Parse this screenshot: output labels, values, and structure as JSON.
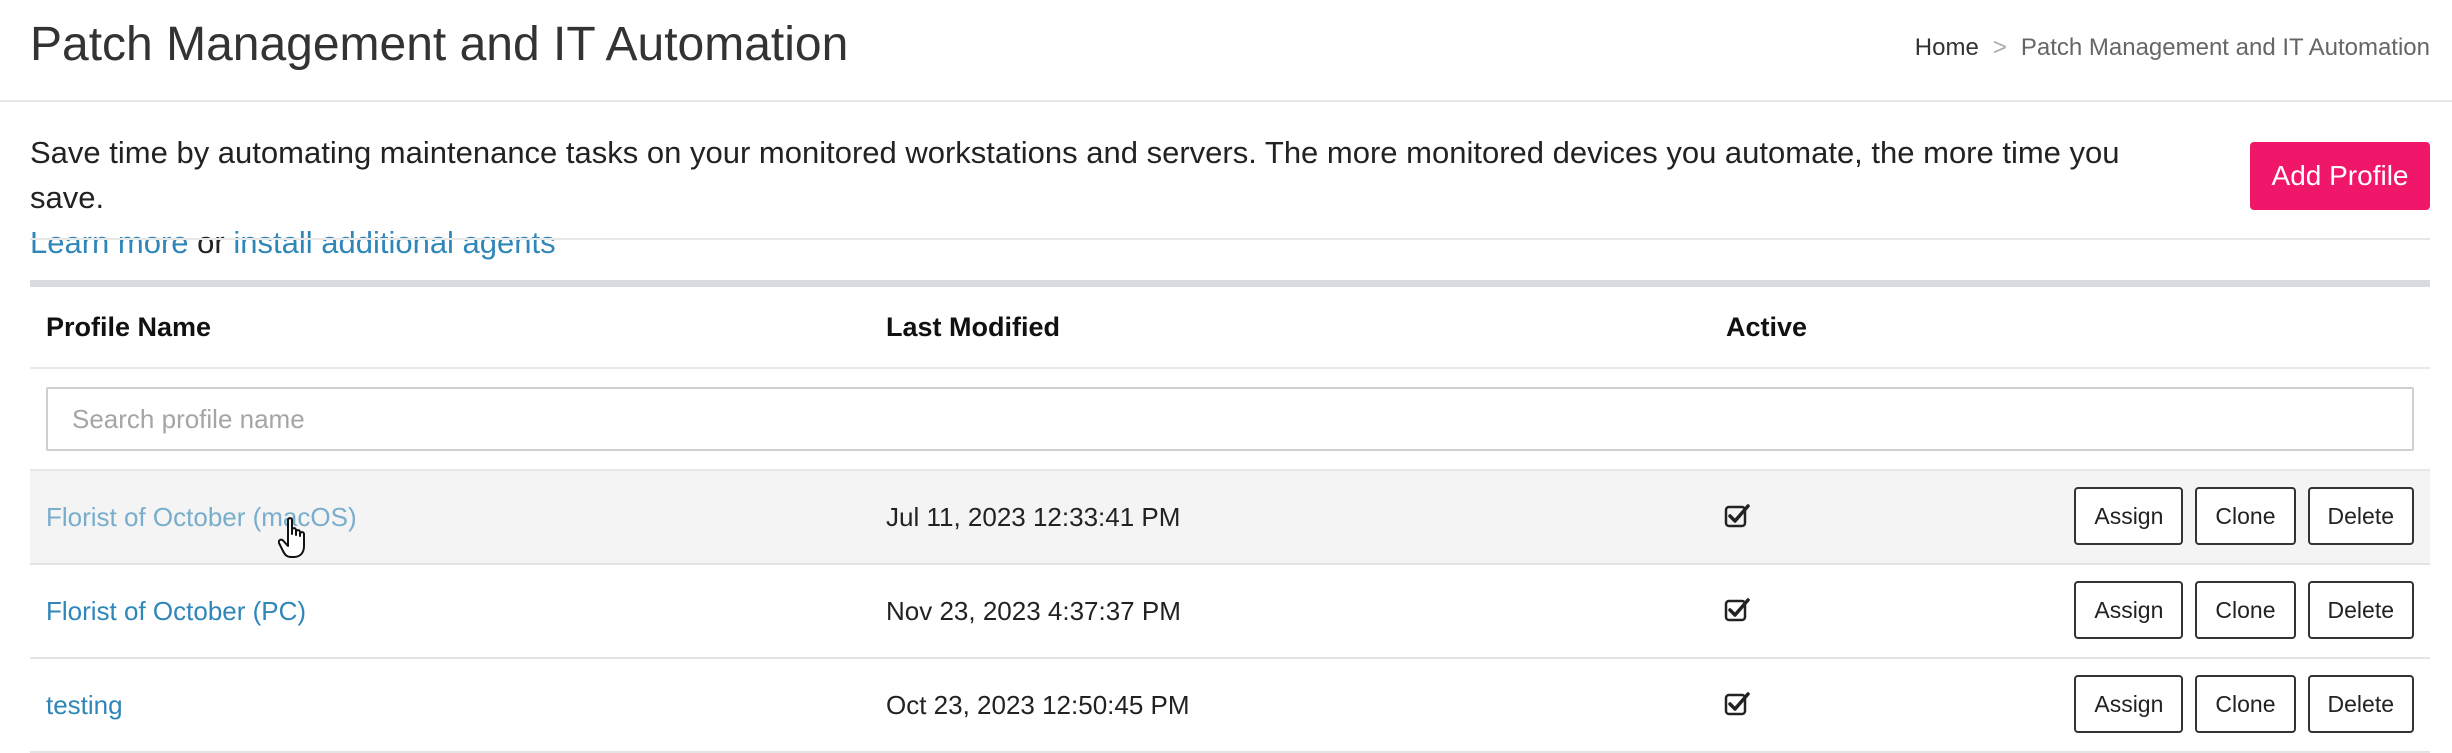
{
  "header": {
    "title": "Patch Management and IT Automation",
    "breadcrumb": {
      "home": "Home",
      "separator": ">",
      "current": "Patch Management and IT Automation"
    }
  },
  "intro": {
    "text": "Save time by automating maintenance tasks on your monitored workstations and servers. The more monitored devices you automate, the more time you save.",
    "learn_more": "Learn more",
    "or": "or",
    "install_agents": "install additional agents"
  },
  "add_profile_label": "Add Profile",
  "table": {
    "columns": {
      "name": "Profile Name",
      "modified": "Last Modified",
      "active": "Active"
    },
    "search_placeholder": "Search profile name",
    "rows": [
      {
        "name": "Florist of October (macOS)",
        "modified": "Jul 11, 2023 12:33:41 PM",
        "active": true
      },
      {
        "name": "Florist of October (PC)",
        "modified": "Nov 23, 2023 4:37:37 PM",
        "active": true
      },
      {
        "name": "testing",
        "modified": "Oct 23, 2023 12:50:45 PM",
        "active": true
      }
    ],
    "actions": {
      "assign": "Assign",
      "clone": "Clone",
      "delete": "Delete"
    }
  },
  "colors": {
    "accent": "#f0166a",
    "link": "#2f86b9"
  },
  "icons": {
    "active": "checked-checkbox-icon",
    "cursor": "hand-pointer-icon"
  }
}
